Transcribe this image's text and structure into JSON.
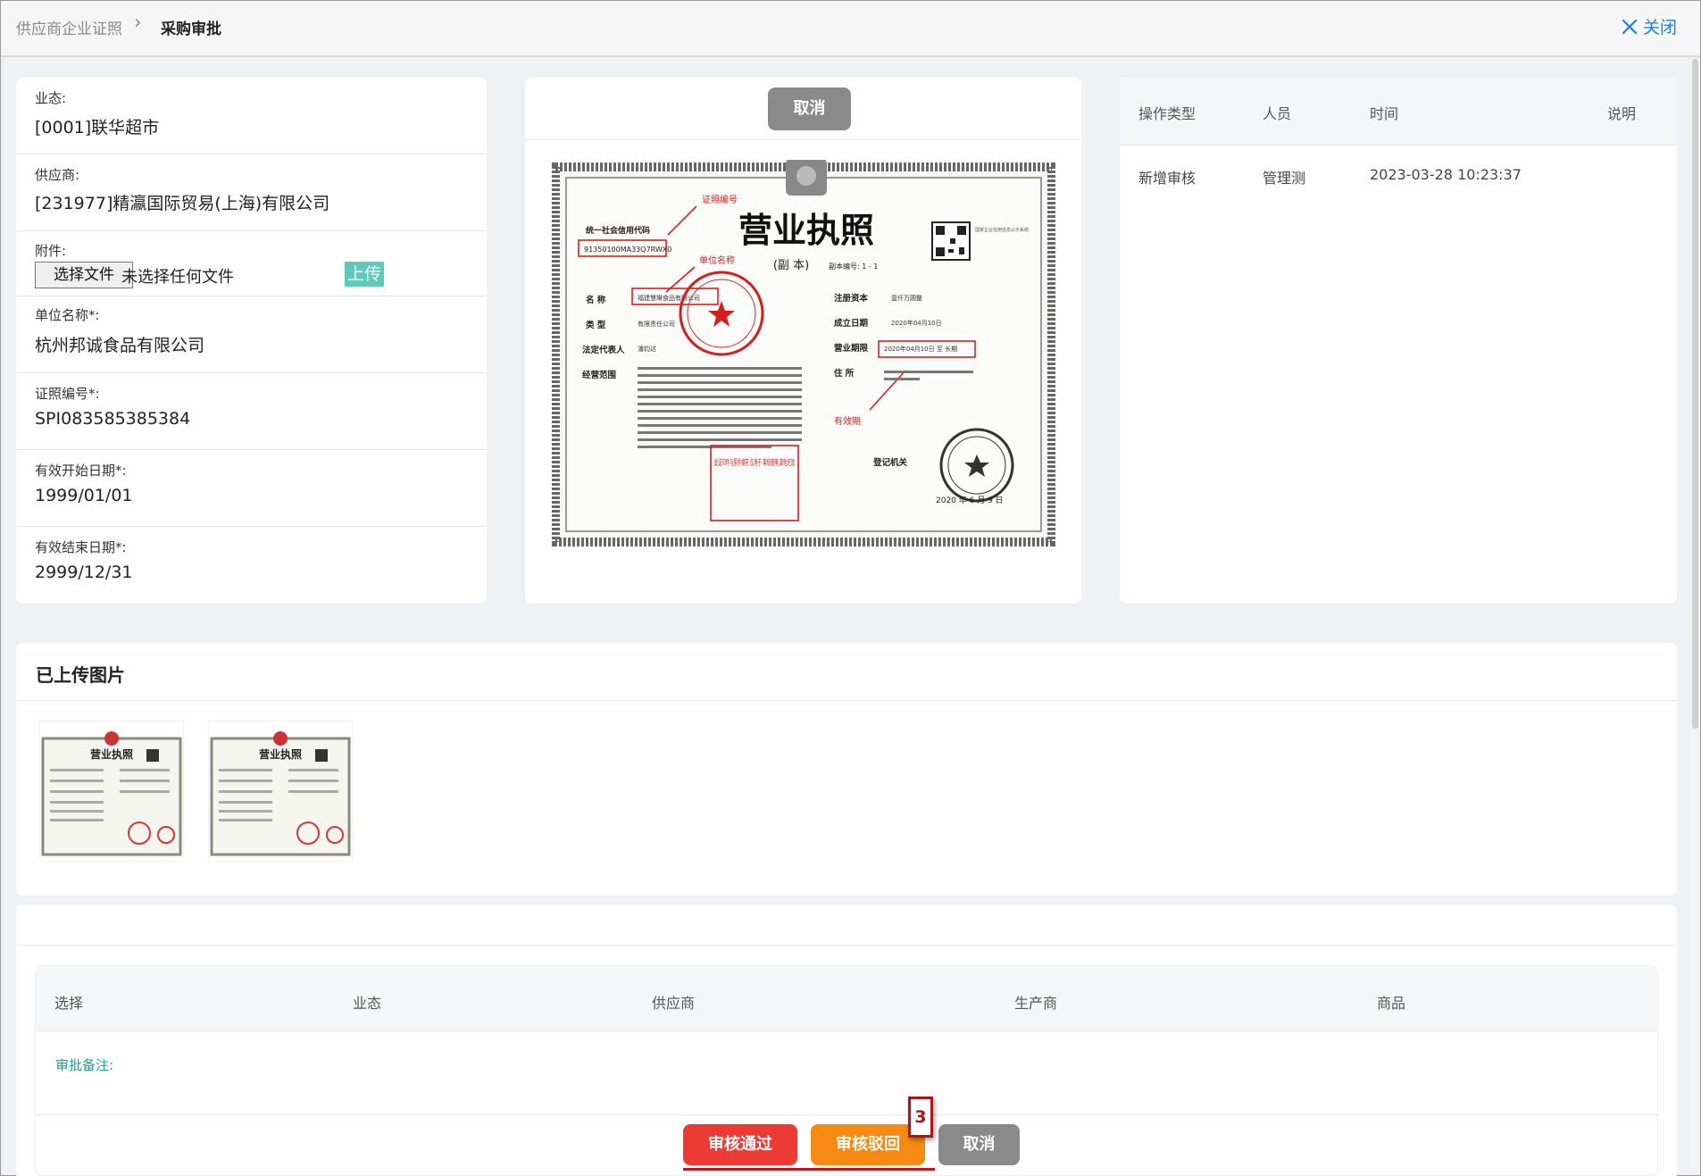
{
  "header": {
    "breadcrumb_parent": "供应商企业证照",
    "breadcrumb_separator": "›",
    "breadcrumb_current": "采购审批",
    "close_label": "关闭",
    "close_icon": "close-x-icon",
    "accent_color": "#1a7ff0"
  },
  "info": {
    "business": {
      "label": "业态:",
      "value": "[0001]联华超市"
    },
    "supplier": {
      "label": "供应商:",
      "value": "[231977]精瀛国际贸易(上海)有限公司"
    },
    "attachment": {
      "label": "附件:",
      "choose_button": "选择文件",
      "no_file": "未选择任何文件",
      "upload_button": "上传"
    },
    "unit_name": {
      "label": "单位名称*:",
      "value": "杭州邦诚食品有限公司"
    },
    "license_no": {
      "label": "证照编号*:",
      "value": "SPI083585385384"
    },
    "start_date": {
      "label": "有效开始日期*:",
      "value": "1999/01/01"
    },
    "end_date": {
      "label": "有效结束日期*:",
      "value": "2999/12/31"
    }
  },
  "preview": {
    "cancel_button": "取消",
    "cert": {
      "title": "营业执照",
      "copy_label": "(副  本)",
      "copy_no": "副本编号: 1 - 1",
      "credit_code_label": "统一社会信用代码",
      "credit_code": "91350100MA33Q7RWX0",
      "anno_code": "证照编号",
      "anno_name": "单位名称",
      "anno_period": "有效期",
      "name_label": "名  称",
      "name_value": "福建慧琳食品有限公司",
      "type_label": "类  型",
      "type_value": "有限责任公司",
      "rep_label": "法定代表人",
      "rep_value": "潘钧达",
      "scope_label": "经营范围",
      "capital_label": "注册资本",
      "capital_value": "壹仟万圆整",
      "est_label": "成立日期",
      "est_value": "2020年04月10日",
      "period_label": "营业期限",
      "period_value": "2020年04月10日 至 长期",
      "address_label": "住  所",
      "reg_label": "登记机关",
      "reg_date": "2020 年  6 月 9 日",
      "stamp_note": "此证印件与原件相符,仅用于 审核使用,其他无效",
      "qr_text": "国家企业信用信息公示系统"
    }
  },
  "log": {
    "headers": [
      "操作类型",
      "人员",
      "时间",
      "说明"
    ],
    "rows": [
      {
        "type": "新增审核",
        "person": "管理测",
        "time": "2023-03-28 10:23:37",
        "note": ""
      }
    ]
  },
  "uploaded": {
    "title": "已上传图片",
    "thumbs": [
      {
        "title": "营业执照"
      },
      {
        "title": "营业执照"
      }
    ]
  },
  "approval": {
    "headers": [
      "选择",
      "业态",
      "供应商",
      "生产商",
      "商品"
    ],
    "remark_label": "审批备注:",
    "approve_button": "审核通过",
    "reject_button": "审核驳回",
    "cancel_button": "取消",
    "annotation_number": "3",
    "colors": {
      "approve": "#ec3a35",
      "reject": "#f78a13",
      "cancel": "#8a8a8a",
      "remark": "#1aa39a"
    }
  }
}
